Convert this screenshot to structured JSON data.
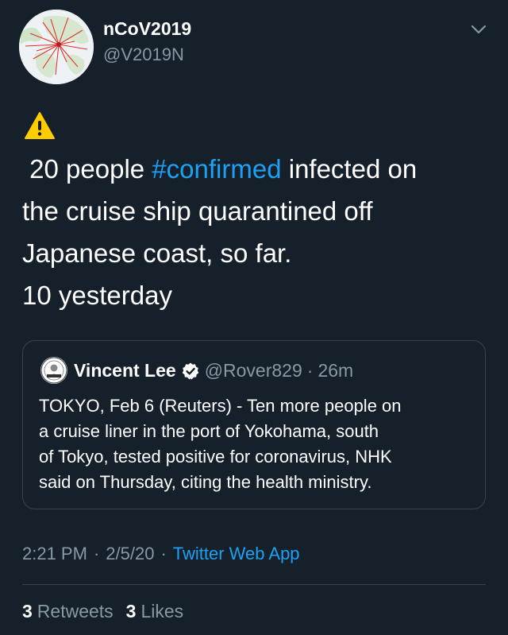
{
  "author": {
    "display_name": "nCoV2019",
    "handle": "@V2019N",
    "avatar_icon": "world-map-avatar"
  },
  "tweet": {
    "emoji": "warning-sign",
    "lines": [
      {
        "before": " 20 people ",
        "hashtag": "#confirmed",
        "after": " infected on"
      },
      "the cruise ship quarantined off",
      "Japanese coast, so far.",
      "10 yesterday"
    ]
  },
  "quoted_tweet": {
    "name": "Vincent Lee",
    "handle": "@Rover829",
    "separator": "·",
    "time": "26m",
    "body_lines": [
      "TOKYO, Feb 6 (Reuters) - Ten more people on",
      "a cruise liner in the port of Yokohama, south",
      "of Tokyo, tested positive for coronavirus, NHK",
      "said on Thursday, citing the health ministry."
    ]
  },
  "meta": {
    "time": "2:21 PM",
    "separator": "·",
    "date": "2/5/20",
    "source": "Twitter Web App"
  },
  "stats": {
    "retweets_count": "3",
    "retweets_label": "Retweets",
    "likes_count": "3",
    "likes_label": "Likes"
  },
  "colors": {
    "background": "#15202b",
    "link": "#1da1f2",
    "secondary_text": "#8899a6",
    "border": "#38444d"
  }
}
